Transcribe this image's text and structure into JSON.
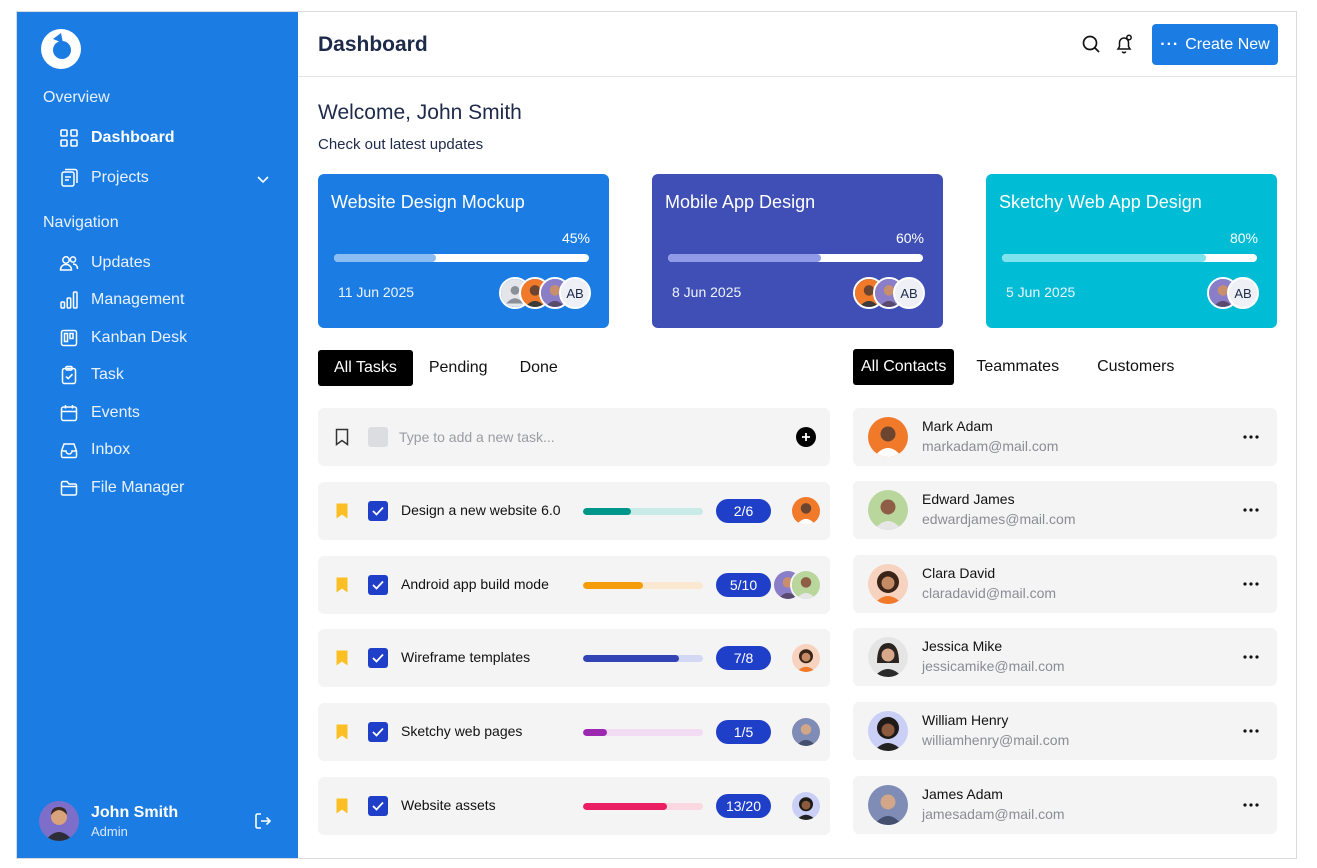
{
  "sidebar": {
    "overview_title": "Overview",
    "navigation_title": "Navigation",
    "overview_items": [
      {
        "label": "Dashboard",
        "icon": "grid-icon"
      },
      {
        "label": "Projects",
        "icon": "document-icon"
      }
    ],
    "navigation_items": [
      {
        "label": "Updates",
        "icon": "users-icon"
      },
      {
        "label": "Management",
        "icon": "bar-chart-icon"
      },
      {
        "label": "Kanban Desk",
        "icon": "kanban-icon"
      },
      {
        "label": "Task",
        "icon": "clipboard-check-icon"
      },
      {
        "label": "Events",
        "icon": "calendar-icon"
      },
      {
        "label": "Inbox",
        "icon": "inbox-icon"
      },
      {
        "label": "File Manager",
        "icon": "folder-icon"
      }
    ],
    "user": {
      "name": "John Smith",
      "role": "Admin"
    }
  },
  "header": {
    "title": "Dashboard",
    "create_label": "Create New"
  },
  "welcome": {
    "title": "Welcome, John Smith",
    "subtitle": "Check out latest updates"
  },
  "projects": [
    {
      "title": "Website Design Mockup",
      "progress_label": "45%",
      "progress": 0.4,
      "date": "11 Jun 2025",
      "initials": "AB",
      "color": "#1b7de3",
      "fill": "#8bbcf2"
    },
    {
      "title": "Mobile App Design",
      "progress_label": "60%",
      "progress": 0.6,
      "date": "8 Jun 2025",
      "initials": "AB",
      "color": "#3f4fb5",
      "fill": "#8f9be6"
    },
    {
      "title": "Sketchy Web App Design",
      "progress_label": "80%",
      "progress": 0.8,
      "date": "5 Jun 2025",
      "initials": "AB",
      "color": "#00bcd4",
      "fill": "#7fe3ee"
    }
  ],
  "task_tabs": [
    "All Tasks",
    "Pending",
    "Done"
  ],
  "contact_tabs": [
    "All Contacts",
    "Teammates",
    "Customers"
  ],
  "new_task": {
    "placeholder": "Type to add a new task..."
  },
  "tasks": [
    {
      "name": "Design a new website 6.0",
      "count": "2/6",
      "progress": 0.4,
      "color": "#00968a",
      "track": "#c8ebe7"
    },
    {
      "name": "Android app build mode",
      "count": "5/10",
      "progress": 0.5,
      "color": "#f59c0a",
      "track": "#fbe8d0"
    },
    {
      "name": "Wireframe templates",
      "count": "7/8",
      "progress": 0.8,
      "color": "#3344b5",
      "track": "#d3d8f5"
    },
    {
      "name": "Sketchy web pages",
      "count": "1/5",
      "progress": 0.2,
      "color": "#9c27b0",
      "track": "#f1dcf4"
    },
    {
      "name": "Website assets",
      "count": "13/20",
      "progress": 0.7,
      "color": "#e91e63",
      "track": "#fbd7e2"
    }
  ],
  "contacts": [
    {
      "name": "Mark Adam",
      "email": "markadam@mail.com"
    },
    {
      "name": "Edward James",
      "email": "edwardjames@mail.com"
    },
    {
      "name": "Clara David",
      "email": "claradavid@mail.com"
    },
    {
      "name": "Jessica Mike",
      "email": "jessicamike@mail.com"
    },
    {
      "name": "William Henry",
      "email": "williamhenry@mail.com"
    },
    {
      "name": "James Adam",
      "email": "jamesadam@mail.com"
    }
  ]
}
